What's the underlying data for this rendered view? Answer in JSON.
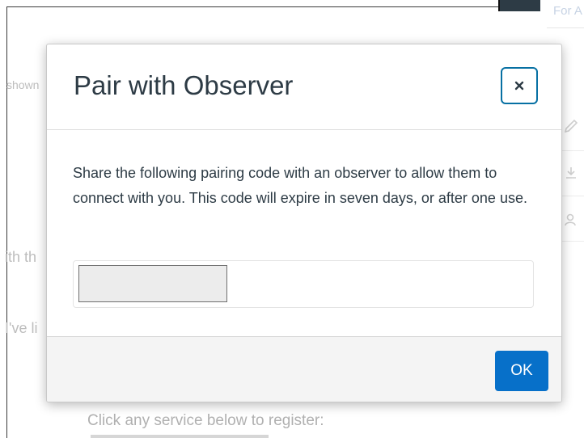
{
  "background": {
    "top_right_text": "For A",
    "left_fragment_shown": "shown",
    "left_fragment_with": "ith th",
    "left_fragment_ive": "I've li",
    "register_prompt": "Click any service below to register:",
    "icons": [
      "pencil-icon",
      "download-icon",
      "person-icon"
    ]
  },
  "modal": {
    "title": "Pair with Observer",
    "close_icon": "×",
    "message": "Share the following pairing code with an observer to allow them to connect with you. This code will expire in seven days, or after one use.",
    "pairing_code": "",
    "ok_label": "OK"
  },
  "colors": {
    "primary_button": "#0770c9",
    "close_focus_ring": "#0770a3",
    "text": "#2d3b45",
    "footer_background": "#f4f4f4"
  }
}
